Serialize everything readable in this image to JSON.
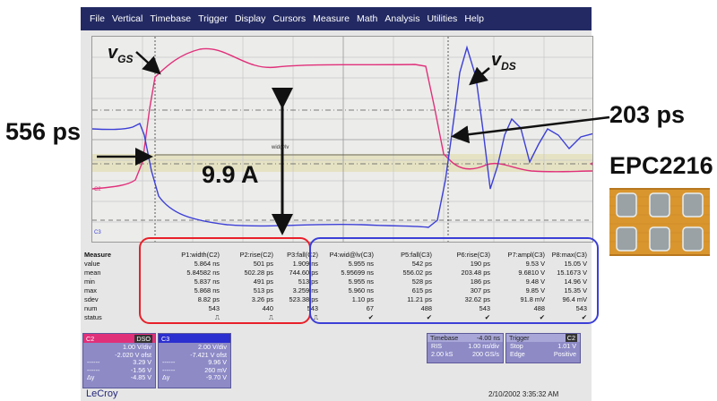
{
  "menu": [
    "File",
    "Vertical",
    "Timebase",
    "Trigger",
    "Display",
    "Cursors",
    "Measure",
    "Math",
    "Analysis",
    "Utilities",
    "Help"
  ],
  "annotations": {
    "vgs_main": "v",
    "vgs_sub": "GS",
    "vds_main": "v",
    "vds_sub": "DS",
    "ps556": "556 ps",
    "ps203": "203 ps",
    "amps": "9.9 A",
    "part": "EPC2216",
    "wid_label": "wid@lv"
  },
  "trace_labels": {
    "c2": "C2",
    "c3": "C3"
  },
  "measure": {
    "title": "Measure",
    "row_labels": [
      "value",
      "mean",
      "min",
      "max",
      "sdev",
      "num",
      "status"
    ],
    "columns": [
      {
        "header": "P1:width(C2)",
        "values": [
          "5.864 ns",
          "5.84582 ns",
          "5.837 ns",
          "5.868 ns",
          "8.82 ps",
          "543",
          "⎍"
        ]
      },
      {
        "header": "P2:rise(C2)",
        "values": [
          "501 ps",
          "502.28 ps",
          "491 ps",
          "513 ps",
          "3.26 ps",
          "440",
          "⎍"
        ]
      },
      {
        "header": "P3:fall(C2)",
        "values": [
          "1.909 ns",
          "744.60 ps",
          "513 ps",
          "3.259 ns",
          "523.38 ps",
          "543",
          "⎍"
        ]
      },
      {
        "header": "P4:wid@lv(C3)",
        "values": [
          "5.955 ns",
          "5.95699 ns",
          "5.955 ns",
          "5.960 ns",
          "1.10 ps",
          "67",
          "✔"
        ]
      },
      {
        "header": "P5:fall(C3)",
        "values": [
          "542 ps",
          "556.02 ps",
          "528 ps",
          "615 ps",
          "11.21 ps",
          "488",
          "✔"
        ]
      },
      {
        "header": "P6:rise(C3)",
        "values": [
          "190 ps",
          "203.48 ps",
          "186 ps",
          "307 ps",
          "32.62 ps",
          "543",
          "✔"
        ]
      },
      {
        "header": "P7:ampl(C3)",
        "values": [
          "9.53 V",
          "9.6810 V",
          "9.48 V",
          "9.85 V",
          "91.8 mV",
          "488",
          "✔"
        ]
      },
      {
        "header": "P8:max(C3)",
        "values": [
          "15.05 V",
          "15.1673 V",
          "14.96 V",
          "15.35 V",
          "96.4 mV",
          "543",
          "✔"
        ]
      }
    ]
  },
  "channels": {
    "c2": {
      "tag": "C2",
      "tag2": "DSO",
      "vdiv": "1.00 V/div",
      "offset": "-2.020 V ofst",
      "l1": "3.29 V",
      "l2": "-1.56 V",
      "dy_label": "Δy",
      "dy": "-4.85 V",
      "l1_label": "------",
      "l2_label": "------"
    },
    "c3": {
      "tag": "C3",
      "tag2": "",
      "vdiv": "2.00 V/div",
      "offset": "-7.421 V ofst",
      "l1": "9.96 V",
      "l2": "260 mV",
      "dy_label": "Δy",
      "dy": "-9.70 V",
      "l1_label": "------",
      "l2_label": "------"
    }
  },
  "timebase": {
    "label": "Timebase",
    "delay": "-4.00 ns",
    "ris_label": "RIS",
    "ris": "1.00 ns/div",
    "samples": "2.00 kS",
    "rate": "200 GS/s"
  },
  "trigger": {
    "label": "Trigger",
    "tag": "C2",
    "stop_label": "Stop",
    "stop": "1.01 V",
    "edge_label": "Edge",
    "edge": "Positive"
  },
  "footer": {
    "brand": "LeCroy",
    "datetime": "2/10/2002 3:35:32 AM"
  },
  "colors": {
    "c2": "#e0307a",
    "c3": "#3c3fd6",
    "menubar": "#232a63",
    "red_box": "#e8202a",
    "panel": "#8d8ac6"
  }
}
